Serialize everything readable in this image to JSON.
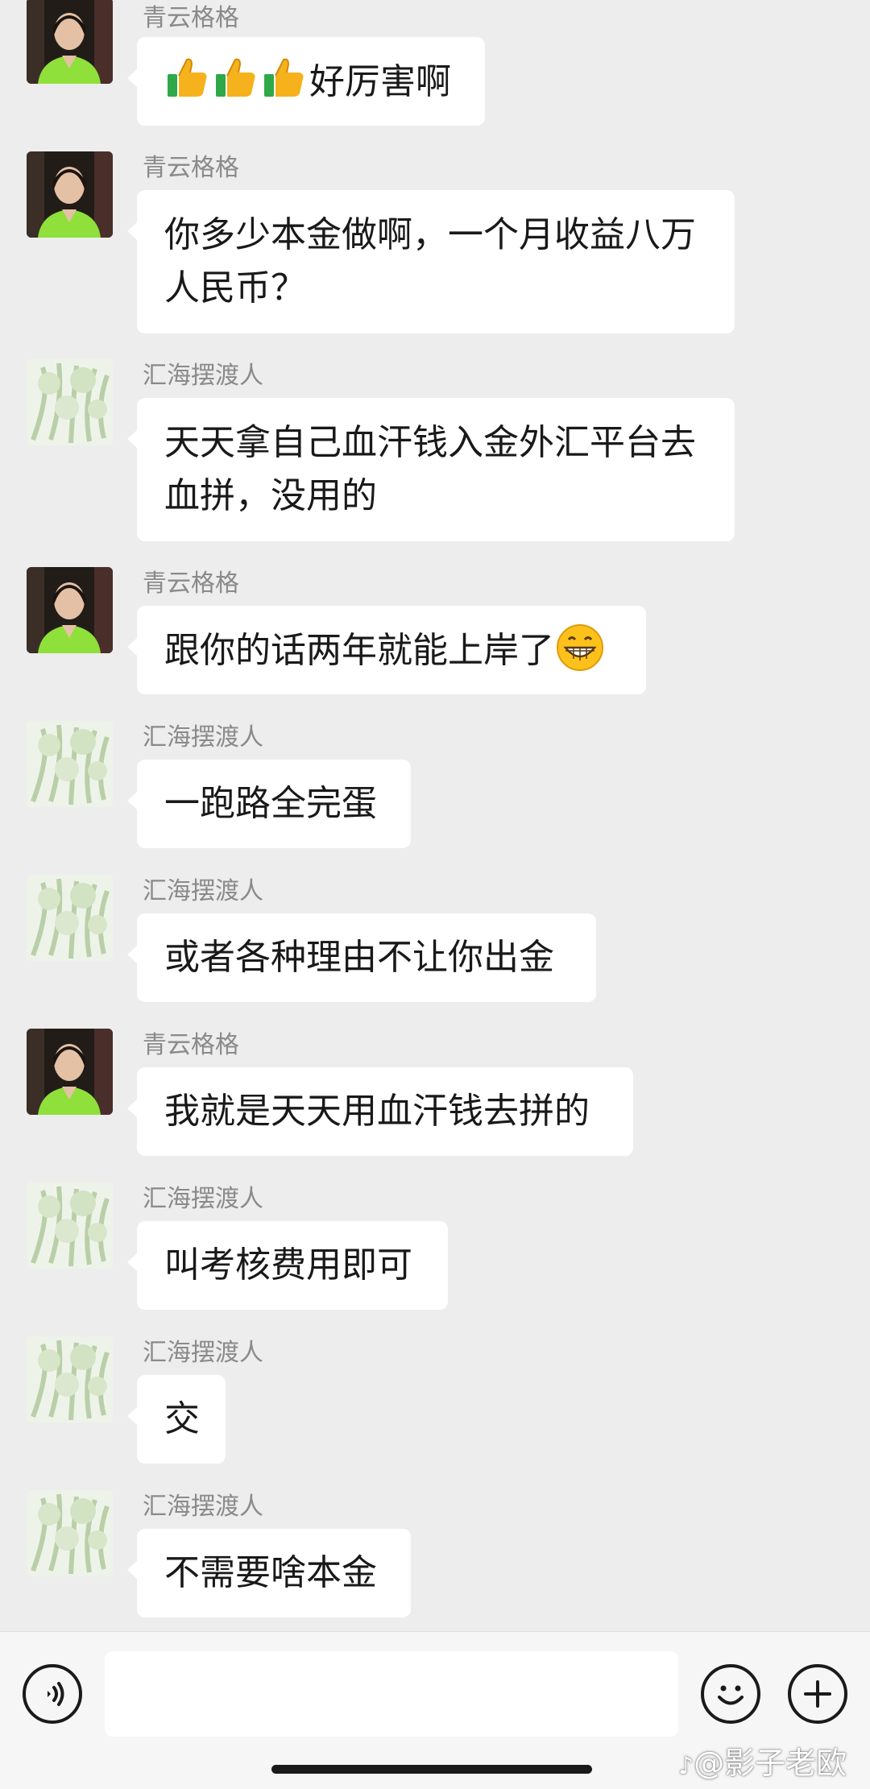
{
  "messages": [
    {
      "sender": "青云格格",
      "text": "好厉害啊",
      "leading_emoji": [
        "thumbs-up-icon",
        "thumbs-up-icon",
        "thumbs-up-icon"
      ]
    },
    {
      "sender": "青云格格",
      "text": "你多少本金做啊，一个月收益八万人民币？"
    },
    {
      "sender": "汇海摆渡人",
      "text": "天天拿自己血汗钱入金外汇平台去血拼，没用的"
    },
    {
      "sender": "青云格格",
      "text": "跟你的话两年就能上岸了",
      "trailing_emoji": "grinning-face-icon"
    },
    {
      "sender": "汇海摆渡人",
      "text": "一跑路全完蛋"
    },
    {
      "sender": "汇海摆渡人",
      "text": "或者各种理由不让你出金"
    },
    {
      "sender": "青云格格",
      "text": "我就是天天用血汗钱去拼的"
    },
    {
      "sender": "汇海摆渡人",
      "text": "叫考核费用即可"
    },
    {
      "sender": "汇海摆渡人",
      "text": "交"
    },
    {
      "sender": "汇海摆渡人",
      "text": "不需要啥本金"
    }
  ],
  "input_bar": {
    "text_value": "",
    "left_icon": "voice-icon",
    "right_icons": [
      "emoji-icon",
      "plus-icon"
    ]
  },
  "watermark": "@影子老欧",
  "colors": {
    "background": "#ededed",
    "bubble": "#ffffff",
    "sender_name": "#8a8a8a",
    "message_text": "#191919"
  }
}
